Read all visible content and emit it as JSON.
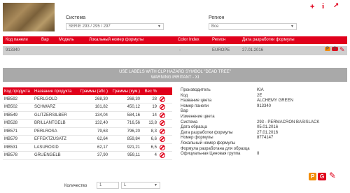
{
  "header": {
    "system_label": "Система",
    "system_value": "SERIE 293 / 295 / 297",
    "region_label": "Регион",
    "region_value": "Все"
  },
  "icons": {
    "add": "plus-icon",
    "info": "info-icon",
    "external": "external-link-icon"
  },
  "results": {
    "columns": [
      "Код панели",
      "Вар",
      "Модель",
      "Локальный номер формулы",
      "Color Index",
      "Регион",
      "Дата разработки формулы"
    ],
    "row": {
      "code": "913340",
      "var": "",
      "model": "",
      "local": "",
      "color_index": "-",
      "region": "EUROPE",
      "date": "27.01.2016"
    }
  },
  "warning": {
    "line1": "USE LABELS WITH CLP HAZARD SYMBOL \"DEAD TREE\"",
    "line2": "WARNING IRRITANT - XI"
  },
  "components": {
    "headers": [
      "Код продукта",
      "Название продукта",
      "Граммы (абс.)",
      "Граммы (кум.)",
      "Вес %"
    ],
    "rows": [
      {
        "code": "MB592",
        "name": "PERLGOLD",
        "abs": "268,30",
        "cum": "268,30",
        "pct": "28"
      },
      {
        "code": "MB502",
        "name": "SCHWARZ",
        "abs": "181,82",
        "cum": "450,12",
        "pct": "19"
      },
      {
        "code": "MB549",
        "name": "GLITZERSILBER",
        "abs": "134,04",
        "cum": "584,16",
        "pct": "14"
      },
      {
        "code": "MB528",
        "name": "BRILLANTGELB",
        "abs": "132,40",
        "cum": "716,56",
        "pct": "13,8"
      },
      {
        "code": "MB571",
        "name": "PERLROSA",
        "abs": "79,63",
        "cum": "796,20",
        "pct": "8,3"
      },
      {
        "code": "MB579",
        "name": "EFFEKTZUSATZ",
        "abs": "62,64",
        "cum": "859,84",
        "pct": "6,6"
      },
      {
        "code": "MB531",
        "name": "LASUROXID",
        "abs": "62,17",
        "cum": "921,21",
        "pct": "6,5"
      },
      {
        "code": "MB578",
        "name": "GRUENGELB",
        "abs": "37,90",
        "cum": "959,11",
        "pct": "4"
      }
    ]
  },
  "quantity": {
    "label": "Количество",
    "value": "1",
    "unit": "L"
  },
  "details": [
    {
      "k": "Производитель",
      "v": "KIA"
    },
    {
      "k": "Код",
      "v": "2E"
    },
    {
      "k": "Название цвета",
      "v": "ALCHEMY GREEN"
    },
    {
      "k": "Номер панели",
      "v": "913340"
    },
    {
      "k": "Вар",
      "v": ""
    },
    {
      "k": "Изменение цвета",
      "v": ""
    },
    {
      "k": "Система",
      "v": "293 - PERMACRON BASISLACK"
    },
    {
      "k": "Дата образца",
      "v": "05.01.2016"
    },
    {
      "k": "Дата разработки формулы",
      "v": "27.01.2016"
    },
    {
      "k": "Номер формулы",
      "v": "8774147"
    },
    {
      "k": "Локальный номер формулы",
      "v": ""
    },
    {
      "k": "Формула разработана для образца",
      "v": ""
    },
    {
      "k": "Официальная Ценовая группа",
      "v": "II"
    }
  ],
  "badges": {
    "p": "P",
    "g": "G"
  },
  "colors": {
    "accent": "#e0001b",
    "orange": "#f28c00",
    "gray_band": "#a9a9a9"
  }
}
